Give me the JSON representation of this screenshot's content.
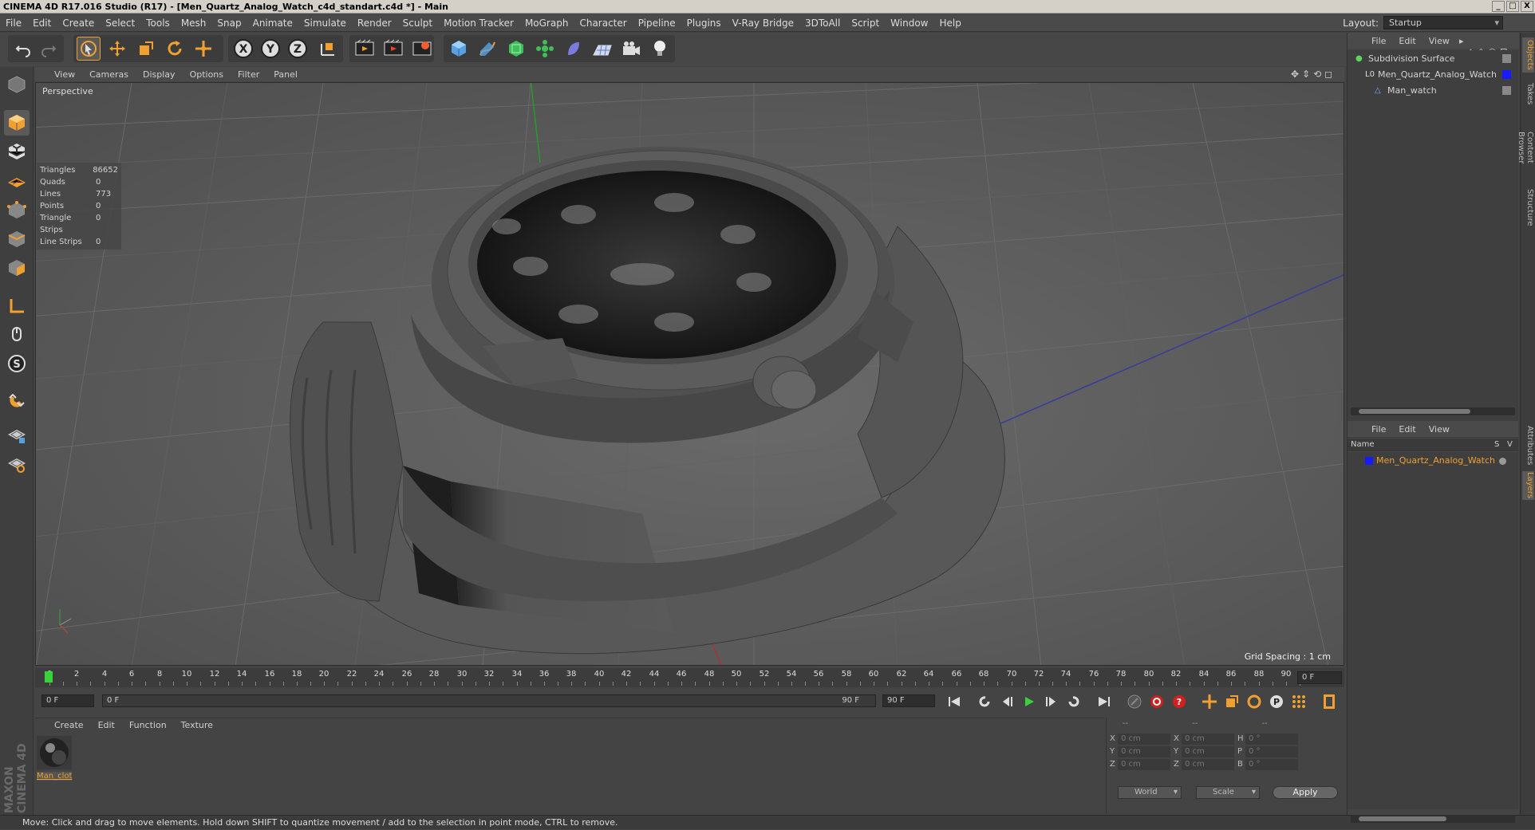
{
  "window": {
    "title": "CINEMA 4D R17.016 Studio (R17) - [Men_Quartz_Analog_Watch_c4d_standart.c4d *] - Main",
    "controls": [
      "_",
      "□",
      "X"
    ]
  },
  "menubar": {
    "items": [
      "File",
      "Edit",
      "Create",
      "Select",
      "Tools",
      "Mesh",
      "Snap",
      "Animate",
      "Simulate",
      "Render",
      "Sculpt",
      "Motion Tracker",
      "MoGraph",
      "Character",
      "Pipeline",
      "Plugins",
      "V-Ray Bridge",
      "3DToAll",
      "Script",
      "Window",
      "Help"
    ],
    "layout_label": "Layout:",
    "layout_value": "Startup"
  },
  "viewport": {
    "menu": [
      "View",
      "Cameras",
      "Display",
      "Options",
      "Filter",
      "Panel"
    ],
    "camera_label": "Perspective",
    "grid_spacing": "Grid Spacing : 1 cm",
    "stats": [
      {
        "label": "Triangles",
        "value": "86652"
      },
      {
        "label": "Quads",
        "value": "0"
      },
      {
        "label": "Lines",
        "value": "773"
      },
      {
        "label": "Points",
        "value": "0"
      },
      {
        "label": "Triangle Strips",
        "value": "0"
      },
      {
        "label": "Line Strips",
        "value": "0"
      }
    ]
  },
  "timeline": {
    "ticks": [
      "0",
      "2",
      "4",
      "6",
      "8",
      "10",
      "12",
      "14",
      "16",
      "18",
      "20",
      "22",
      "24",
      "26",
      "28",
      "30",
      "32",
      "34",
      "36",
      "38",
      "40",
      "42",
      "44",
      "46",
      "48",
      "50",
      "52",
      "54",
      "56",
      "58",
      "60",
      "62",
      "64",
      "66",
      "68",
      "70",
      "72",
      "74",
      "76",
      "78",
      "80",
      "82",
      "84",
      "86",
      "88",
      "90"
    ],
    "current_frame": "0 F",
    "start_field": "0 F",
    "range_start": "0 F",
    "range_end": "90 F",
    "end_field": "90 F"
  },
  "materials": {
    "menu": [
      "Create",
      "Edit",
      "Function",
      "Texture"
    ],
    "items": [
      {
        "name": "Man_clot"
      }
    ]
  },
  "coordinates": {
    "headers": [
      "--",
      "--",
      "--"
    ],
    "rows": [
      {
        "a": "X",
        "av": "0 cm",
        "b": "X",
        "bv": "0 cm",
        "c": "H",
        "cv": "0 °"
      },
      {
        "a": "Y",
        "av": "0 cm",
        "b": "Y",
        "bv": "0 cm",
        "c": "P",
        "cv": "0 °"
      },
      {
        "a": "Z",
        "av": "0 cm",
        "b": "Z",
        "bv": "0 cm",
        "c": "B",
        "cv": "0 °"
      }
    ],
    "mode_select": "World",
    "size_select": "Scale",
    "apply_label": "Apply"
  },
  "object_manager": {
    "menu": [
      "File",
      "Edit",
      "View"
    ],
    "objects": [
      {
        "name": "Subdivision Surface",
        "indent": 0
      },
      {
        "name": "Men_Quartz_Analog_Watch",
        "indent": 1
      },
      {
        "name": "Man_watch",
        "indent": 2
      }
    ]
  },
  "layer_manager": {
    "menu": [
      "File",
      "Edit",
      "View"
    ],
    "col_name": "Name",
    "col_s": "S",
    "col_v": "V",
    "layers": [
      {
        "name": "Men_Quartz_Analog_Watch",
        "color": "#1a1aff"
      }
    ]
  },
  "side_tabs": {
    "top": [
      "Objects",
      "Takes",
      "Content Browser",
      "Structure"
    ],
    "bottom": [
      "Attributes",
      "Layers"
    ]
  },
  "branding": {
    "logo_text": "MAXON CINEMA 4D"
  },
  "status": {
    "text": "Move: Click and drag to move elements. Hold down SHIFT to quantize movement / add to the selection in point mode, CTRL to remove."
  },
  "colors": {
    "accent_orange": "#f0a030",
    "object_green": "#5fd35f",
    "layer_blue": "#1a1aff"
  }
}
